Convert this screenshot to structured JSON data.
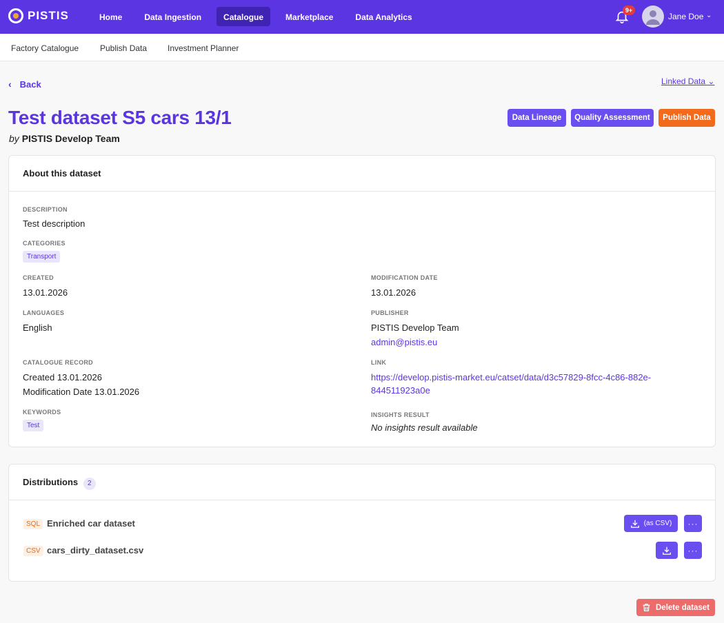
{
  "app": {
    "logo_text": "PISTIS",
    "nav": [
      "Home",
      "Data Ingestion",
      "Catalogue",
      "Marketplace",
      "Data Analytics"
    ],
    "notifications_badge": "9+",
    "user_name": "Jane Doe"
  },
  "subnav": [
    "Factory Catalogue",
    "Publish Data",
    "Investment Planner"
  ],
  "page": {
    "back_label": "Back",
    "linked_data_label": "Linked Data",
    "title": "Test dataset S5 cars 13/1",
    "by_prefix": "by",
    "author": "PISTIS Develop Team",
    "actions": [
      "Data Lineage",
      "Quality Assessment",
      "Publish Data"
    ]
  },
  "about": {
    "heading": "About this dataset",
    "description_label": "DESCRIPTION",
    "description": "Test description",
    "categories_label": "CATEGORIES",
    "category": "Transport",
    "created_label": "CREATED",
    "created": "13.01.2026",
    "modification_label": "MODIFICATION DATE",
    "modification": "13.01.2026",
    "languages_label": "LANGUAGES",
    "language": "English",
    "publisher_label": "PUBLISHER",
    "publisher_name": "PISTIS Develop Team",
    "publisher_email": "admin@pistis.eu",
    "record_label": "CATALOGUE RECORD",
    "record_created": "Created 13.01.2026",
    "record_modified": "Modification Date 13.01.2026",
    "link_label": "LINK",
    "link_line1": "https://develop.pistis-market.eu/catset/data/d3c57829-8fcc-4c86-882e-",
    "link_line2": "844511923a0e",
    "keywords_label": "KEYWORDS",
    "keyword": "Test",
    "insights_label": "INSIGHTS RESULT",
    "insights": "No insights result available"
  },
  "distributions": {
    "heading": "Distributions",
    "count": "2",
    "items": [
      {
        "format": "SQL",
        "name": "Enriched car dataset",
        "download_label": "(as CSV)"
      },
      {
        "format": "CSV",
        "name": "cars_dirty_dataset.csv",
        "download_label": ""
      }
    ]
  },
  "delete_label": "Delete dataset",
  "colors": {
    "brand": "#5b35e2",
    "accent_orange": "#f26a1b",
    "danger": "#ec6b6b"
  }
}
